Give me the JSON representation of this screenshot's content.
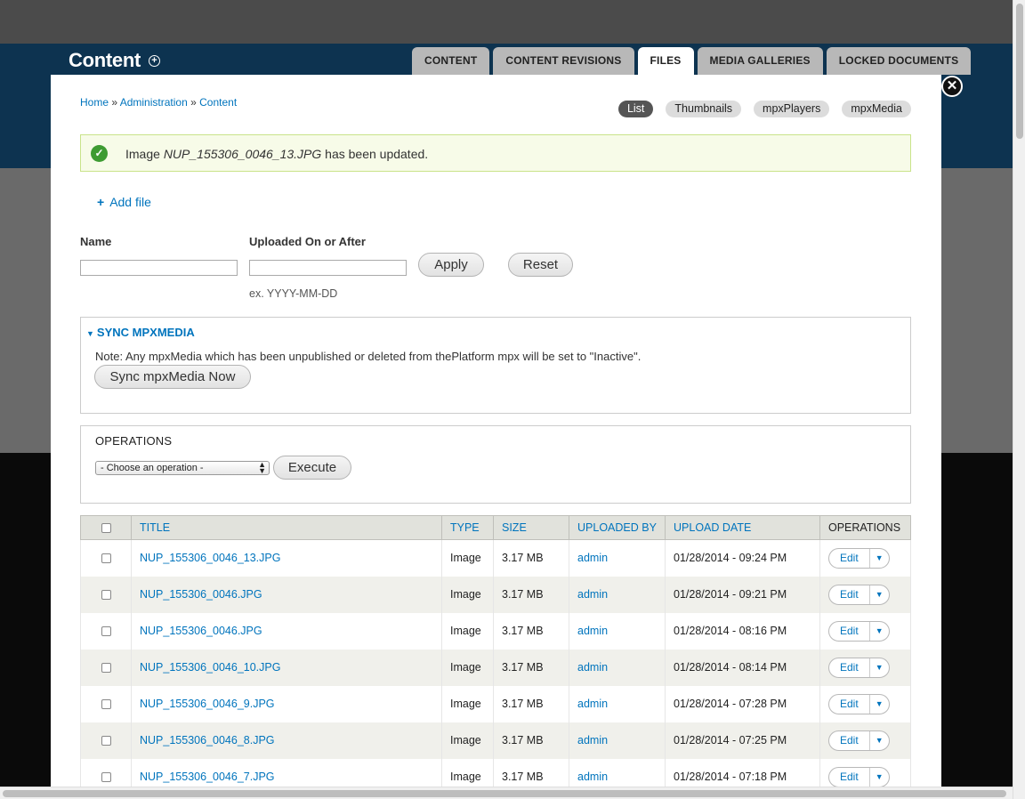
{
  "page": {
    "title": "Content"
  },
  "tabs": [
    {
      "label": "CONTENT",
      "active": false
    },
    {
      "label": "CONTENT REVISIONS",
      "active": false
    },
    {
      "label": "FILES",
      "active": true
    },
    {
      "label": "MEDIA GALLERIES",
      "active": false
    },
    {
      "label": "LOCKED DOCUMENTS",
      "active": false
    }
  ],
  "breadcrumb": {
    "items": [
      "Home",
      "Administration",
      "Content"
    ],
    "separator": "»"
  },
  "view_modes": [
    "List",
    "Thumbnails",
    "mpxPlayers",
    "mpxMedia"
  ],
  "message": {
    "prefix": "Image ",
    "filename": "NUP_155306_0046_13.JPG",
    "suffix": " has been updated."
  },
  "add_file_label": "Add file",
  "filters": {
    "name_label": "Name",
    "name_value": "",
    "uploaded_label": "Uploaded On or After",
    "uploaded_value": "",
    "date_hint": "ex. YYYY-MM-DD",
    "apply_label": "Apply",
    "reset_label": "Reset"
  },
  "sync": {
    "legend": "SYNC MPXMEDIA",
    "note": "Note: Any mpxMedia which has been unpublished or deleted from thePlatform mpx will be set to \"Inactive\".",
    "button": "Sync mpxMedia Now"
  },
  "operations": {
    "legend": "OPERATIONS",
    "select_value": "- Choose an operation -",
    "execute_label": "Execute"
  },
  "table": {
    "headers": {
      "title": "TITLE",
      "type": "TYPE",
      "size": "SIZE",
      "uploaded_by": "UPLOADED BY",
      "upload_date": "UPLOAD DATE",
      "operations": "OPERATIONS"
    },
    "edit_label": "Edit",
    "rows": [
      {
        "title": "NUP_155306_0046_13.JPG",
        "type": "Image",
        "size": "3.17 MB",
        "uploaded_by": "admin",
        "date": "01/28/2014 - 09:24 PM"
      },
      {
        "title": "NUP_155306_0046.JPG",
        "type": "Image",
        "size": "3.17 MB",
        "uploaded_by": "admin",
        "date": "01/28/2014 - 09:21 PM"
      },
      {
        "title": "NUP_155306_0046.JPG",
        "type": "Image",
        "size": "3.17 MB",
        "uploaded_by": "admin",
        "date": "01/28/2014 - 08:16 PM"
      },
      {
        "title": "NUP_155306_0046_10.JPG",
        "type": "Image",
        "size": "3.17 MB",
        "uploaded_by": "admin",
        "date": "01/28/2014 - 08:14 PM"
      },
      {
        "title": "NUP_155306_0046_9.JPG",
        "type": "Image",
        "size": "3.17 MB",
        "uploaded_by": "admin",
        "date": "01/28/2014 - 07:28 PM"
      },
      {
        "title": "NUP_155306_0046_8.JPG",
        "type": "Image",
        "size": "3.17 MB",
        "uploaded_by": "admin",
        "date": "01/28/2014 - 07:25 PM"
      },
      {
        "title": "NUP_155306_0046_7.JPG",
        "type": "Image",
        "size": "3.17 MB",
        "uploaded_by": "admin",
        "date": "01/28/2014 - 07:18 PM"
      }
    ]
  }
}
